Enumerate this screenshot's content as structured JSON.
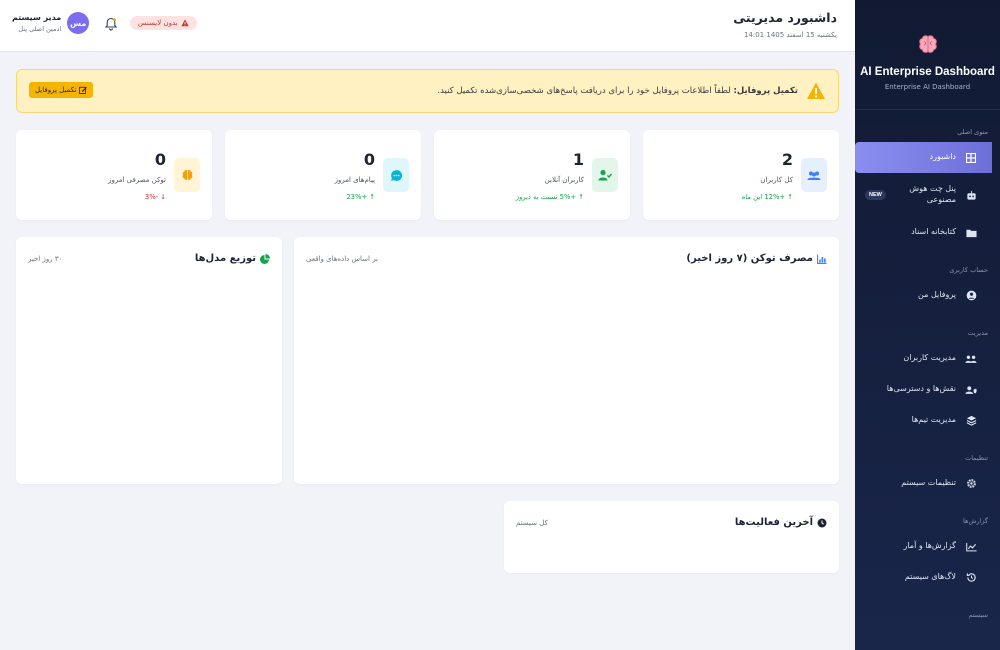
{
  "sidebar": {
    "brand_title": "AI Enterprise Dashboard",
    "brand_subtitle": "Enterprise AI Dashboard",
    "sections": {
      "main": "منوی اصلی",
      "account": "حساب کاربری",
      "management": "مدیریت",
      "settings": "تنظیمات",
      "reports": "گزارش‌ها",
      "system": "سیستم"
    },
    "items": {
      "dashboard": "داشبورد",
      "ai_chat": "پنل چت هوش مصنوعی",
      "ai_chat_badge": "NEW",
      "docs": "کتابخانه اسناد",
      "profile": "پروفایل من",
      "users": "مدیریت کاربران",
      "roles": "نقش‌ها و دسترسی‌ها",
      "teams": "مدیریت تیم‌ها",
      "system_settings": "تنظیمات سیستم",
      "reports": "گزارش‌ها و آمار",
      "logs": "لاگ‌های سیستم"
    }
  },
  "header": {
    "title": "داشبورد مدیریتی",
    "date": "یکشنبه 15 اسفند 1405 14:01",
    "license": "بدون لایسنس",
    "user_name": "مدیر سیستم",
    "user_role": "ادمین اصلی پنل",
    "avatar_initials": "مس"
  },
  "banner": {
    "title": "تکمیل پروفایل:",
    "message": "لطفاً اطلاعات پروفایل خود را برای دریافت پاسخ‌های شخصی‌سازی‌شده تکمیل کنید.",
    "button": "تکمیل پروفایل"
  },
  "stats": [
    {
      "value": "2",
      "label": "کل کاربران",
      "trend": "+12% این ماه",
      "dir": "up",
      "color": "#3b82f6",
      "bg": "#e6effd"
    },
    {
      "value": "1",
      "label": "کاربران آنلاین",
      "trend": "+5% نسبت به دیروز",
      "dir": "up",
      "color": "#16a34a",
      "bg": "#e3f6ea"
    },
    {
      "value": "0",
      "label": "پیام‌های امروز",
      "trend": "+23%",
      "dir": "up",
      "color": "#06b6d4",
      "bg": "#dff6fb"
    },
    {
      "value": "0",
      "label": "توکن مصرفی امروز",
      "trend": "-3%",
      "dir": "down",
      "color": "#f59e0b",
      "bg": "#fff4d6"
    }
  ],
  "panels": {
    "token_title": "مصرف توکن (۷ روز اخیر)",
    "token_sub": "بر اساس داده‌های واقعی",
    "models_title": "توزیع مدل‌ها",
    "models_sub": "۳۰ روز اخیر",
    "activity_title": "آخرین فعالیت‌ها",
    "activity_sub": "کل سیستم"
  },
  "colors": {
    "accent": "#7a6df0",
    "sidebar_bg": "#121a33",
    "warning": "#f5b400"
  }
}
